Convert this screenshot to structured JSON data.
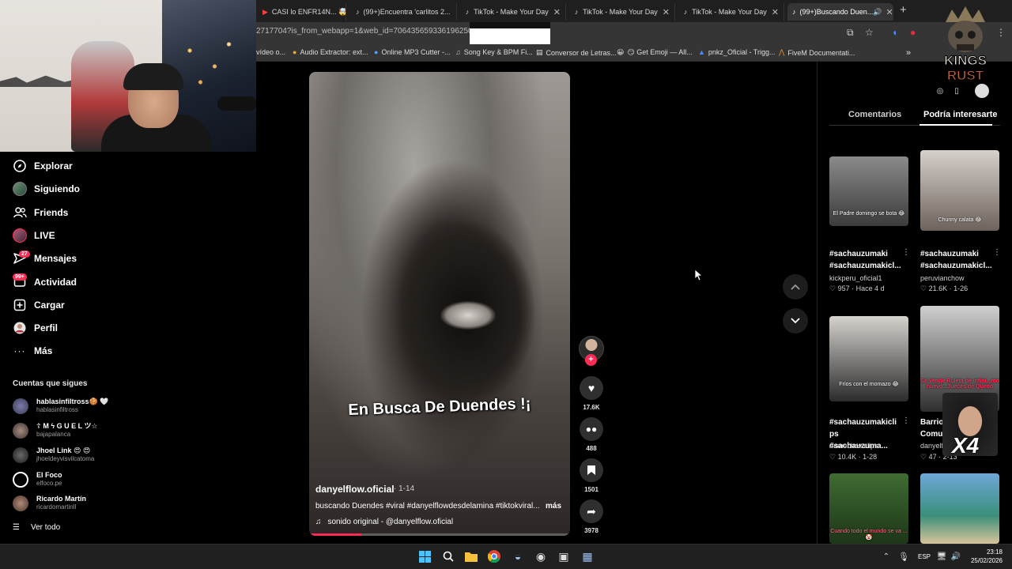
{
  "browser": {
    "tabs": [
      {
        "title": "CASI lo ENFR14N... 🤯",
        "favicon": "youtube-icon"
      },
      {
        "title": "(99+)Encuentra 'carlitos 2...",
        "favicon": "tiktok-icon"
      },
      {
        "title": "TikTok - Make Your Day",
        "favicon": "tiktok-icon"
      },
      {
        "title": "TikTok - Make Your Day",
        "favicon": "tiktok-icon"
      },
      {
        "title": "TikTok - Make Your Day",
        "favicon": "tiktok-icon"
      },
      {
        "title": "(99+)Buscando Duen...",
        "favicon": "tiktok-icon",
        "active": true
      }
    ],
    "url": "2717704?is_from_webapp=1&web_id=7064356593361962501",
    "bookmarks": [
      {
        "label": "vídeo o..."
      },
      {
        "label": "Audio Extractor: ext..."
      },
      {
        "label": "Online MP3 Cutter -..."
      },
      {
        "label": "Song Key & BPM Fi..."
      },
      {
        "label": "Conversor de Letras..."
      },
      {
        "label": "😏 Get Emoji — All..."
      },
      {
        "label": "pnkz_Oficial - Trigg..."
      },
      {
        "label": "FiveM Documentati..."
      }
    ],
    "bookmarks_more": "»"
  },
  "sidebar": {
    "items": [
      {
        "label": "Explorar",
        "icon": "compass-icon"
      },
      {
        "label": "Siguiendo",
        "icon": "avatar-icon"
      },
      {
        "label": "Friends",
        "icon": "friends-icon"
      },
      {
        "label": "LIVE",
        "icon": "live-icon"
      },
      {
        "label": "Mensajes",
        "icon": "messages-icon",
        "badge": "27"
      },
      {
        "label": "Actividad",
        "icon": "activity-icon",
        "badge": "99+"
      },
      {
        "label": "Cargar",
        "icon": "upload-icon"
      },
      {
        "label": "Perfil",
        "icon": "profile-icon"
      },
      {
        "label": "Más",
        "icon": "more-icon"
      }
    ],
    "following_title": "Cuentas que sigues",
    "accounts": [
      {
        "name": "hablasinfiltross🍪 🤍",
        "handle": "hablasinfiltross"
      },
      {
        "name": "☦ M ϟ G U E L ツ☆",
        "handle": "bajapalanca"
      },
      {
        "name": "Jhoel Link 😍 😍",
        "handle": "jhoeldeyvisvilcatoma"
      },
      {
        "name": "El Foco",
        "handle": "elfoco.pe"
      },
      {
        "name": "Ricardo Martín",
        "handle": "ricardomartinll"
      }
    ],
    "see_all": "Ver todo"
  },
  "video": {
    "caption": "En Busca De Duendes !¡",
    "author": "danyelflow.oficial",
    "date": "· 1-14",
    "description": "buscando Duendes #viral #danyelflowdesdelamina #tiktokviral...",
    "more": "más",
    "sound": "sonido original - @danyelflow.oficial",
    "progress": 0.2
  },
  "actions": {
    "likes": "17.6K",
    "comments": "488",
    "saves": "1501",
    "shares": "3978"
  },
  "right_panel": {
    "tabs": [
      "Comentarios",
      "Podría interesarte"
    ],
    "active_tab": "Podría interesarte",
    "cards": [
      {
        "caption": "El Padre domingo se bota 😂",
        "title": "#sachauzumaki #sachauzumakicl...",
        "user": "kickperu_oficial1",
        "likes": "957",
        "time": "Hace 4 d"
      },
      {
        "caption": "Chunny calata 😂",
        "title": "#sachauzumaki #sachauzumakicl...",
        "user": "peruvianchow",
        "likes": "21.6K",
        "time": "1-26"
      },
      {
        "caption": "Fríos con el momazo 😂",
        "title": "#sachauzumakicli ps #sachauzuma...",
        "user": "damechowclips",
        "likes": "10.4K",
        "time": "1-28"
      },
      {
        "caption": "Se Vende Ruleta de infini...mo nuevo...Jueces de Quedo",
        "title": "Barrio Comunid...",
        "user": "danyelflov...",
        "likes": "47",
        "time": "2-13"
      },
      {
        "caption": "Cuando todo el mundo se va ... 🤡",
        "title": "",
        "user": "",
        "likes": "",
        "time": ""
      },
      {
        "caption": "",
        "title": "",
        "user": "",
        "likes": "",
        "time": ""
      }
    ]
  },
  "overlay": {
    "logo_top": "KINGS",
    "logo_bottom": "RUST",
    "mini_cam_text": "X4"
  },
  "taskbar": {
    "lang": "ESP",
    "time": "23:18",
    "date": "25/02/2026"
  },
  "colors": {
    "accent": "#fe2c55",
    "background": "#000000",
    "taskbar": "#202020",
    "chrome": "#353535"
  }
}
